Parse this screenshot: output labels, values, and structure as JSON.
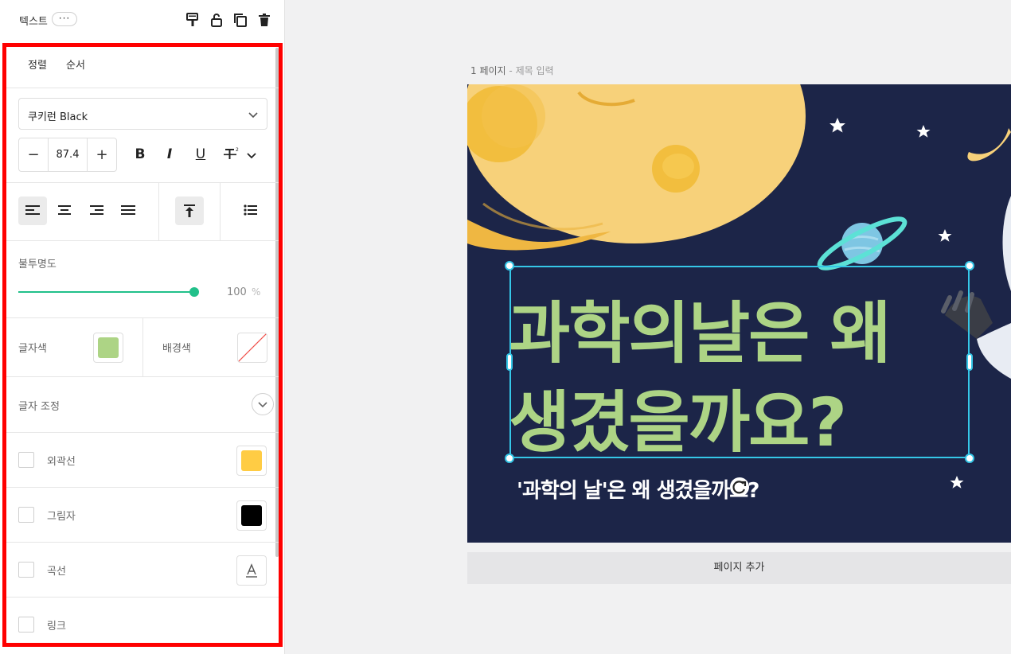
{
  "panel": {
    "header": {
      "title": "텍스트",
      "more": "···"
    },
    "tabs": [
      "정렬",
      "순서"
    ],
    "font": {
      "name": "쿠키런 Black"
    },
    "size": {
      "minus": "−",
      "value": "87.4",
      "plus": "+"
    },
    "format": {
      "bold": "B",
      "italic": "I",
      "underline": "U"
    },
    "opacity": {
      "label": "불투명도",
      "value": "100",
      "unit": "%",
      "level": 1.0
    },
    "colors": {
      "text_label": "글자색",
      "text_color": "#add485",
      "bg_label": "배경색"
    },
    "adjust": {
      "label": "글자 조정"
    },
    "effects": [
      {
        "label": "외곽선",
        "color": "#ffcc44"
      },
      {
        "label": "그림자",
        "color": "#000000"
      },
      {
        "label": "곡선"
      },
      {
        "label": "링크"
      }
    ]
  },
  "canvas": {
    "page_number": "1 페이지",
    "page_title_placeholder": "제목 입력",
    "title_lines": [
      "과학의날은 왜",
      "생겼을까요?"
    ],
    "subtitle": "'과학의 날'은 왜 생겼을까요?",
    "add_page": "페이지 추가"
  },
  "colors": {
    "accent": "#22c08a",
    "highlight": "#ff0000",
    "selection": "#35c7e8",
    "slide_bg": "#1c2548",
    "moon": "#f7d17a"
  }
}
